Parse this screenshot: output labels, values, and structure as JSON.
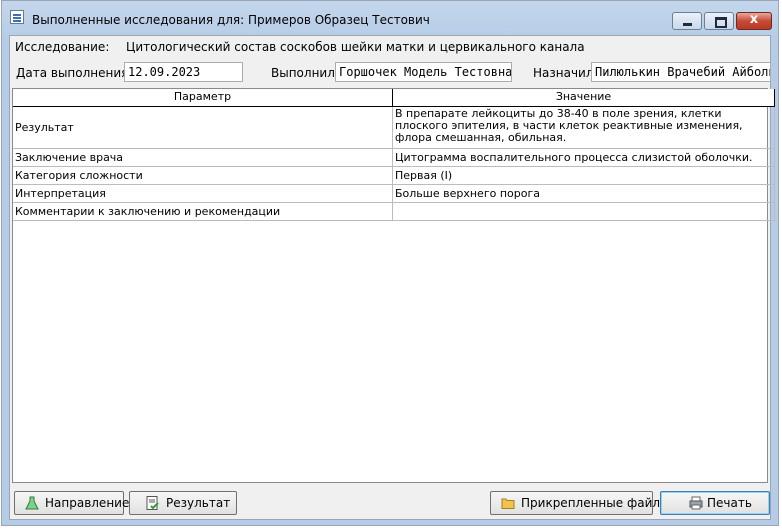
{
  "window": {
    "title": "Выполненные исследования для: Примеров Образец Тестович",
    "close_label": "x"
  },
  "header": {
    "study_label": "Исследование:",
    "study_value": "Цитологический состав соскобов шейки матки и цервикального канала",
    "date_label": "Дата выполнения:",
    "date_value": "12.09.2023",
    "performer_label": "Выполнил:",
    "performer_value": "Горшочек Модель Тестовна",
    "assigned_label": "Назначил:",
    "assigned_value": "Пилюлькин Врачебий Айболит"
  },
  "table": {
    "columns": [
      "Параметр",
      "Значение"
    ],
    "rows": [
      {
        "param": "Результат",
        "value": "В препарате лейкоциты до 38-40 в поле зрения, клетки плоского эпителия,  в части клеток реактивные изменения,  флора смешанная, обильная."
      },
      {
        "param": "Заключение врача",
        "value": " Цитограмма воспалительного процесса слизистой оболочки."
      },
      {
        "param": "Категория сложности",
        "value": "Первая (I)"
      },
      {
        "param": "Интерпретация",
        "value": "Больше верхнего порога"
      },
      {
        "param": "Комментарии к заключению и рекомендации",
        "value": ""
      }
    ]
  },
  "buttons": {
    "direction": "Направление",
    "result": "Результат",
    "files": "Прикрепленные файлы",
    "print": "Печать"
  },
  "icons": [
    "app-icon",
    "minimize-icon",
    "maximize-icon",
    "close-icon",
    "flask-icon",
    "document-check-icon",
    "folder-icon",
    "printer-icon"
  ],
  "colors": {
    "titlebar": "#b6cce6",
    "close_button": "#c74a37",
    "panel": "#f0f0f0"
  }
}
